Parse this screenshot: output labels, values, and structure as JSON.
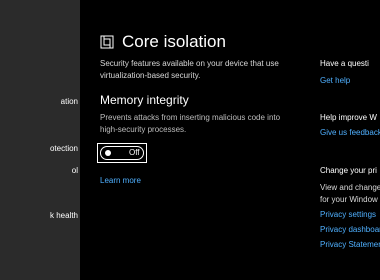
{
  "sidebar": {
    "items": [
      {
        "label": "ation"
      },
      {
        "label": "otection"
      },
      {
        "label": "ol"
      },
      {
        "label": "k health"
      }
    ]
  },
  "main": {
    "title": "Core isolation",
    "icon": "core-isolation-chip-icon",
    "description": "Security features available on your device that use virtualization-based security.",
    "memory_integrity": {
      "heading": "Memory integrity",
      "description": "Prevents attacks from inserting malicious code into high-security processes.",
      "toggle_state": "Off"
    },
    "learn_more": "Learn more"
  },
  "right_panel": {
    "question": {
      "heading": "Have a questi",
      "link": "Get help"
    },
    "improve": {
      "heading": "Help improve W",
      "link": "Give us feedback"
    },
    "privacy": {
      "heading": "Change your pri",
      "text_line1": "View and change",
      "text_line2": "for your Window",
      "links": [
        "Privacy settings",
        "Privacy dashboard",
        "Privacy Statement"
      ]
    }
  },
  "colors": {
    "link": "#4fb0ff",
    "sidebar": "#2b2b2b",
    "background": "#000000"
  }
}
